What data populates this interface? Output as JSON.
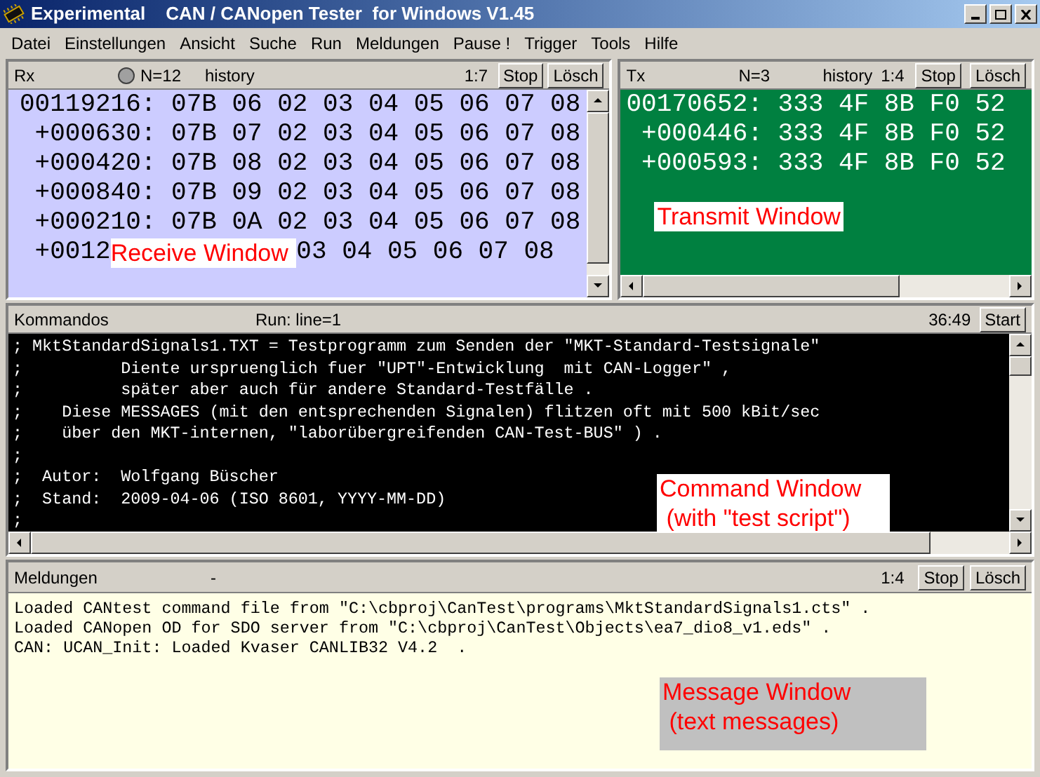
{
  "window": {
    "title": "Experimental    CAN / CANopen Tester  for Windows V1.45"
  },
  "menu": [
    "Datei",
    "Einstellungen",
    "Ansicht",
    "Suche",
    "Run",
    "Meldungen",
    "Pause !",
    "Trigger",
    "Tools",
    "Hilfe"
  ],
  "rx": {
    "title": "Rx",
    "led_on": false,
    "count": "N=12",
    "history": "history",
    "ratio": "1:7",
    "buttons": [
      "Stop",
      "Lösch"
    ],
    "rows": [
      {
        "text": "00119216: 07B 06 02 03 04 05 06 07 08"
      },
      {
        "text": " +000630: 07B 07 02 03 04 05 06 07 08"
      },
      {
        "text": " +000420: 07B 08 02 03 04 05 06 07 08"
      },
      {
        "text": " +000840: 07B 09 02 03 04 05 06 07 08"
      },
      {
        "text": " +000210: 07B 0A 02 03 04 05 06 07 08"
      },
      {
        "text": " +0012",
        "callout": "Receive Window",
        "tail": "03 04 05 06 07 08"
      }
    ]
  },
  "tx": {
    "title": "Tx",
    "count": "N=3",
    "history": "history",
    "ratio": "1:4",
    "buttons": [
      "Stop",
      "Lösch"
    ],
    "rows": [
      "00170652: 333 4F 8B F0 52",
      " +000446: 333 4F 8B F0 52",
      " +000593: 333 4F 8B F0 52"
    ],
    "callout": "Transmit Window"
  },
  "commands": {
    "title": "Kommandos",
    "status": "Run: line=1",
    "time": "36:49",
    "button": "Start",
    "lines": [
      "; MktStandardSignals1.TXT = Testprogramm zum Senden der \"MKT-Standard-Testsignale\"",
      ";          Diente urspruenglich fuer \"UPT\"-Entwicklung  mit CAN-Logger\" ,",
      ";          später aber auch für andere Standard-Testfälle .",
      ";    Diese MESSAGES (mit den entsprechenden Signalen) flitzen oft mit 500 kBit/sec",
      ";    über den MKT-internen, \"laborübergreifenden CAN-Test-BUS\" ) .",
      ";",
      ";  Autor:  Wolfgang Büscher",
      ";  Stand:  2009-04-06 (ISO 8601, YYYY-MM-DD)",
      ";"
    ],
    "callout": [
      "Command Window",
      " (with \"test script\")"
    ]
  },
  "messages": {
    "title": "Meldungen",
    "status": "-",
    "ratio": "1:4",
    "buttons": [
      "Stop",
      "Lösch"
    ],
    "lines": [
      "Loaded CANtest command file from \"C:\\cbproj\\CanTest\\programs\\MktStandardSignals1.cts\" .",
      "Loaded CANopen OD for SDO server from \"C:\\cbproj\\CanTest\\Objects\\ea7_dio8_v1.eds\" .",
      "CAN: UCAN_Init: Loaded Kvaser CANLIB32 V4.2  ."
    ],
    "callout": [
      "Message Window",
      " (text messages)"
    ]
  }
}
